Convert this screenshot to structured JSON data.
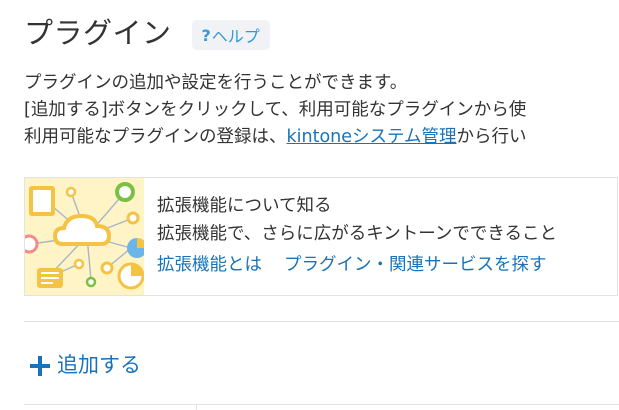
{
  "header": {
    "title": "プラグイン",
    "help": {
      "mark": "?",
      "label": "ヘルプ"
    }
  },
  "description": {
    "line1": "プラグインの追加や設定を行うことができます。",
    "line2": "[追加する]ボタンをクリックして、利用可能なプラグインから使",
    "line3_before": "利用可能なプラグインの登録は、",
    "line3_link": "kintoneシステム管理",
    "line3_after": "から行い"
  },
  "promo": {
    "title": "拡張機能について知る",
    "subtitle": "拡張機能で、さらに広がるキントーンでできること",
    "links": [
      {
        "label": "拡張機能とは"
      },
      {
        "label": "プラグイン・関連サービスを探す"
      }
    ]
  },
  "actions": {
    "add_label": "追加する"
  },
  "colors": {
    "link": "#1a73b8",
    "help_text": "#3498db",
    "illust_bg": "#fff4c6"
  }
}
